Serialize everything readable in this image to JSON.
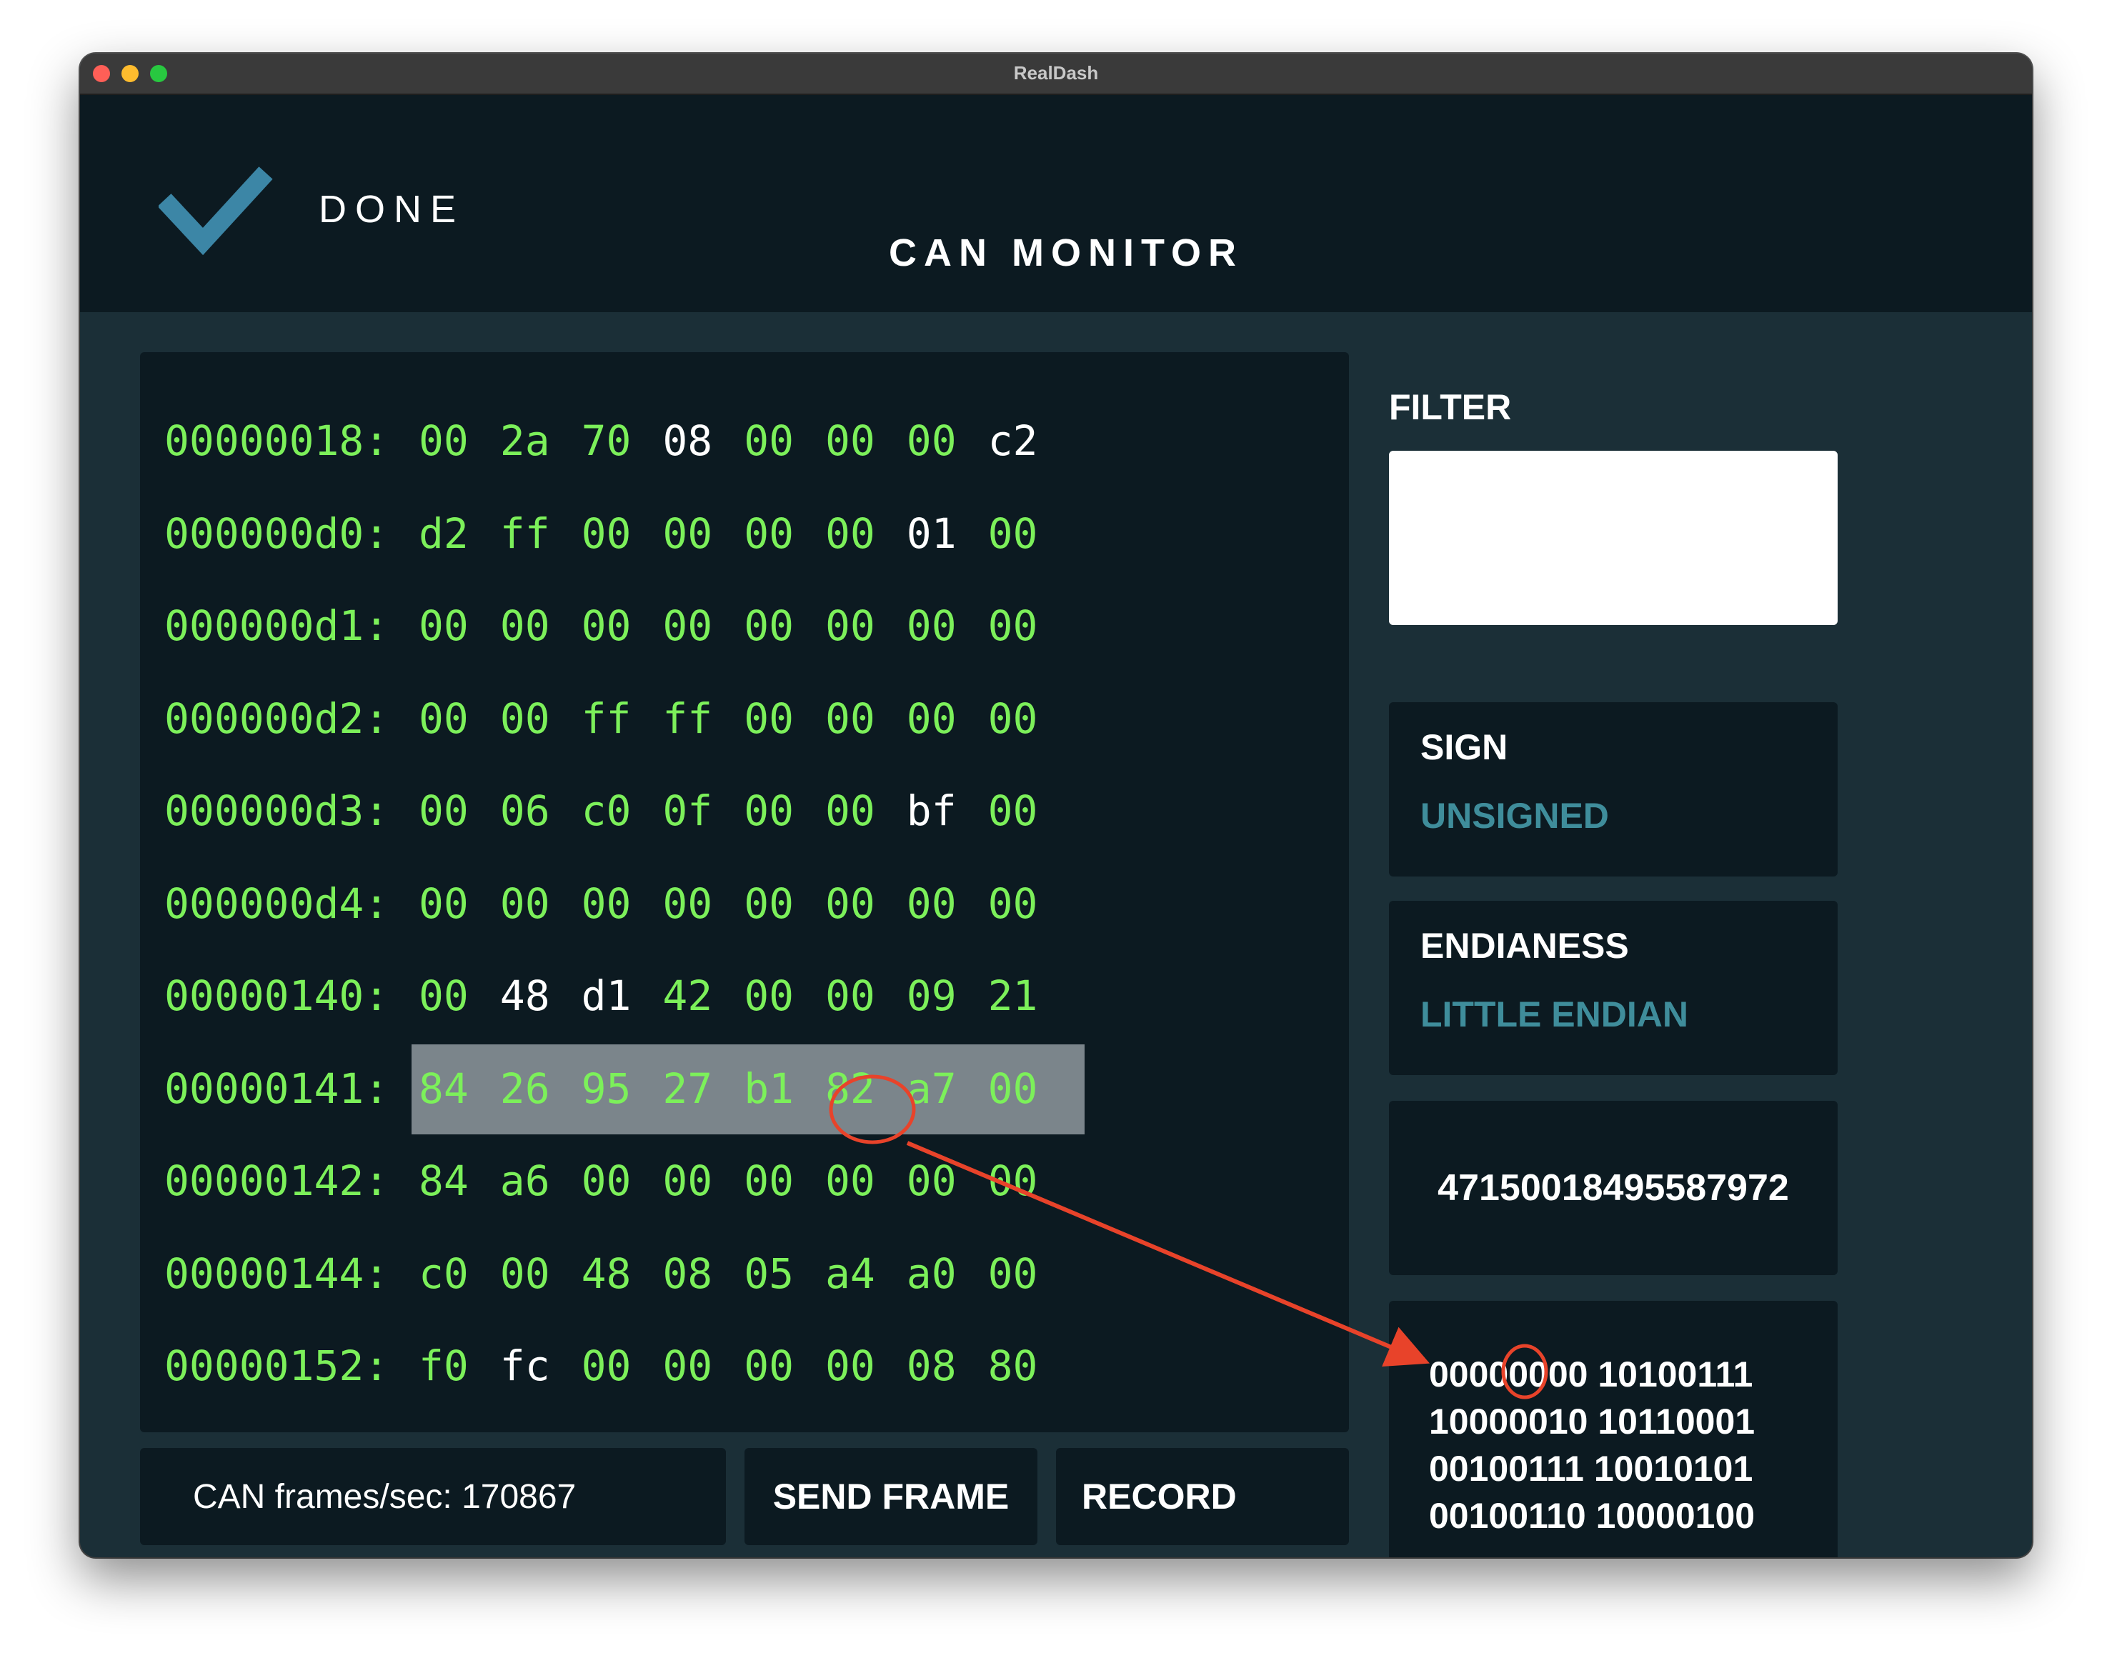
{
  "window": {
    "title": "RealDash"
  },
  "header": {
    "done_label": "DONE",
    "title": "CAN MONITOR"
  },
  "hex_rows": [
    {
      "addr": "00000018:",
      "bytes": [
        "00",
        "2a",
        "70",
        "08",
        "00",
        "00",
        "00",
        "c2"
      ],
      "changed": [
        3,
        7
      ],
      "highlight": false
    },
    {
      "addr": "000000d0:",
      "bytes": [
        "d2",
        "ff",
        "00",
        "00",
        "00",
        "00",
        "01",
        "00"
      ],
      "changed": [
        6
      ],
      "highlight": false
    },
    {
      "addr": "000000d1:",
      "bytes": [
        "00",
        "00",
        "00",
        "00",
        "00",
        "00",
        "00",
        "00"
      ],
      "changed": [],
      "highlight": false
    },
    {
      "addr": "000000d2:",
      "bytes": [
        "00",
        "00",
        "ff",
        "ff",
        "00",
        "00",
        "00",
        "00"
      ],
      "changed": [],
      "highlight": false
    },
    {
      "addr": "000000d3:",
      "bytes": [
        "00",
        "06",
        "c0",
        "0f",
        "00",
        "00",
        "bf",
        "00"
      ],
      "changed": [
        6
      ],
      "highlight": false
    },
    {
      "addr": "000000d4:",
      "bytes": [
        "00",
        "00",
        "00",
        "00",
        "00",
        "00",
        "00",
        "00"
      ],
      "changed": [],
      "highlight": false
    },
    {
      "addr": "00000140:",
      "bytes": [
        "00",
        "48",
        "d1",
        "42",
        "00",
        "00",
        "09",
        "21"
      ],
      "changed": [
        1,
        2
      ],
      "highlight": false
    },
    {
      "addr": "00000141:",
      "bytes": [
        "84",
        "26",
        "95",
        "27",
        "b1",
        "82",
        "a7",
        "00"
      ],
      "changed": [],
      "highlight": true
    },
    {
      "addr": "00000142:",
      "bytes": [
        "84",
        "a6",
        "00",
        "00",
        "00",
        "00",
        "00",
        "00"
      ],
      "changed": [],
      "highlight": false
    },
    {
      "addr": "00000144:",
      "bytes": [
        "c0",
        "00",
        "48",
        "08",
        "05",
        "a4",
        "a0",
        "00"
      ],
      "changed": [],
      "highlight": false
    },
    {
      "addr": "00000152:",
      "bytes": [
        "f0",
        "fc",
        "00",
        "00",
        "00",
        "00",
        "08",
        "80"
      ],
      "changed": [
        1
      ],
      "highlight": false
    }
  ],
  "footer": {
    "fps_text": "CAN frames/sec: 170867",
    "send_label": "SEND FRAME",
    "record_label": "RECORD"
  },
  "filter": {
    "label": "FILTER",
    "value": ""
  },
  "sign": {
    "title": "SIGN",
    "value": "UNSIGNED"
  },
  "endianess": {
    "title": "ENDIANESS",
    "value": "LITTLE ENDIAN"
  },
  "decimal_value": "47150018495587972",
  "binary_lines": [
    "00000000 10100111",
    "10000010 10110001",
    "00100111 10010101",
    "00100110 10000100"
  ],
  "colors": {
    "hex_text": "#7cf05a",
    "changed_text": "#ffffff",
    "panel_bg": "#0c1a21",
    "window_bg": "#1b2f37",
    "accent": "#3f8d9b",
    "check_color": "#3c86a6",
    "annotation": "#e8432a"
  },
  "icons": {
    "done": "checkmark-icon"
  }
}
